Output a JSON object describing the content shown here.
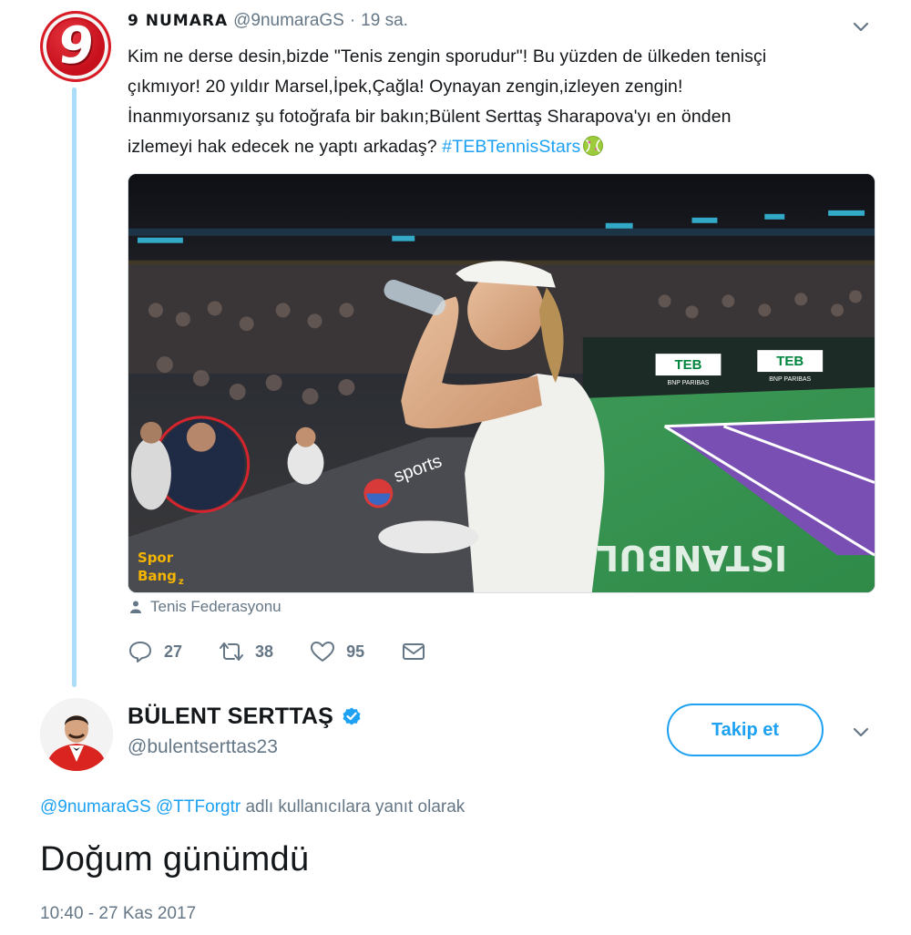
{
  "parent_tweet": {
    "display_name": "9 NUMARA",
    "handle": "@9numaraGS",
    "dot": "·",
    "time_ago": "19 sa.",
    "avatar_label": "9",
    "text_lines": [
      "Kim ne derse desin,bizde \"Tenis zengin sporudur\"! Bu yüzden de ülkeden tenisçi",
      "çıkmıyor! 20 yıldır Marsel,İpek,Çağla! Oynayan zengin,izleyen zengin!",
      "İnanmıyorsanız şu fotoğrafa  bir bakın;Bülent Serttaş Sharapova'yı en önden"
    ],
    "last_line_text": "izlemeyi hak edecek ne yaptı arkadaş? ",
    "hashtag": "#TEBTennisStars",
    "photo_tag": "Tenis Federasyonu",
    "photo_overlay": {
      "watermark_line1": "Spor",
      "watermark_line2": "Bang",
      "watermark_z": "z",
      "banner_brand": "sports",
      "sponsor_1": "TEB",
      "sponsor_1_sub": "BNP PARIBAS",
      "sponsor_2": "TEB",
      "sponsor_2_sub": "BNP PARIBAS",
      "court_text": "ISTANBUL"
    },
    "reply_count": "27",
    "retweet_count": "38",
    "like_count": "95"
  },
  "reply_tweet": {
    "display_name": "BÜLENT SERTTAŞ",
    "handle": "@bulentserttas23",
    "follow_label": "Takip et",
    "reply_mention_1": "@9numaraGS",
    "reply_mention_2": "@TTForgtr",
    "reply_suffix": " adlı kullanıcılara yanıt olarak",
    "text": "Doğum günümdü",
    "timestamp": "10:40 - 27 Kas 2017"
  },
  "colors": {
    "accent": "#1da1f2",
    "muted": "#657786",
    "thread_line": "#abdcf9",
    "avatar_red": "#c8101d"
  },
  "icons": [
    "chevron-down-icon",
    "person-tag-icon",
    "reply-icon",
    "retweet-icon",
    "like-icon",
    "direct-message-icon",
    "verified-badge-icon",
    "tennis-ball-emoji"
  ]
}
